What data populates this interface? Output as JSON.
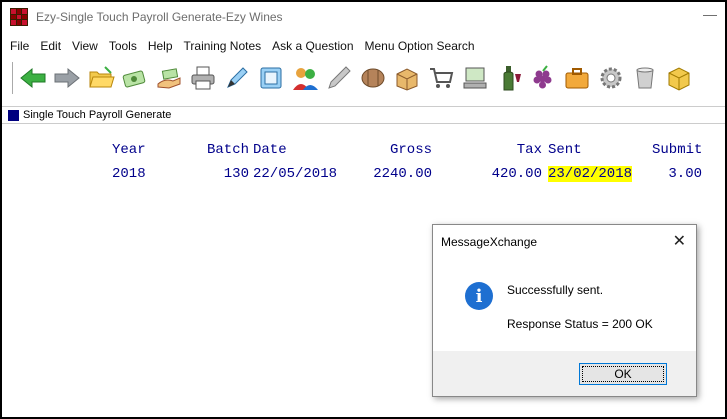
{
  "window": {
    "title": "Ezy-Single Touch Payroll Generate-Ezy Wines",
    "minimize_glyph": "—"
  },
  "menu": {
    "items": [
      "File",
      "Edit",
      "View",
      "Tools",
      "Help",
      "Training Notes",
      "Ask a Question",
      "Menu Option Search"
    ]
  },
  "toolbar": {
    "icons": [
      "back-arrow-icon",
      "forward-arrow-icon",
      "folder-open-icon",
      "money-icon",
      "hand-money-icon",
      "printer-icon",
      "pen-icon",
      "calculator-icon",
      "people-icon",
      "pencil-icon",
      "barrel-icon",
      "box-icon",
      "cart-icon",
      "computer-icon",
      "wine-bottle-icon",
      "grapes-icon",
      "briefcase-icon",
      "settings-gear-icon",
      "bucket-icon",
      "cube-icon"
    ]
  },
  "subheader": {
    "title": "Single Touch Payroll Generate"
  },
  "table": {
    "headers": {
      "year": "Year",
      "batch": "Batch",
      "date": "Date",
      "gross": "Gross",
      "tax": "Tax",
      "sent": "Sent",
      "submit": "Submit"
    },
    "row": {
      "year": "2018",
      "batch": "130",
      "date": "22/05/2018",
      "gross": "2240.00",
      "tax": "420.00",
      "sent": "23/02/2018",
      "submit": "3.00"
    },
    "highlight_color": "#ffff00"
  },
  "dialog": {
    "title": "MessageXchange",
    "close_glyph": "✕",
    "info_glyph": "i",
    "message": "Successfully sent.",
    "status": "Response Status = 200 OK",
    "ok_label": "OK"
  }
}
